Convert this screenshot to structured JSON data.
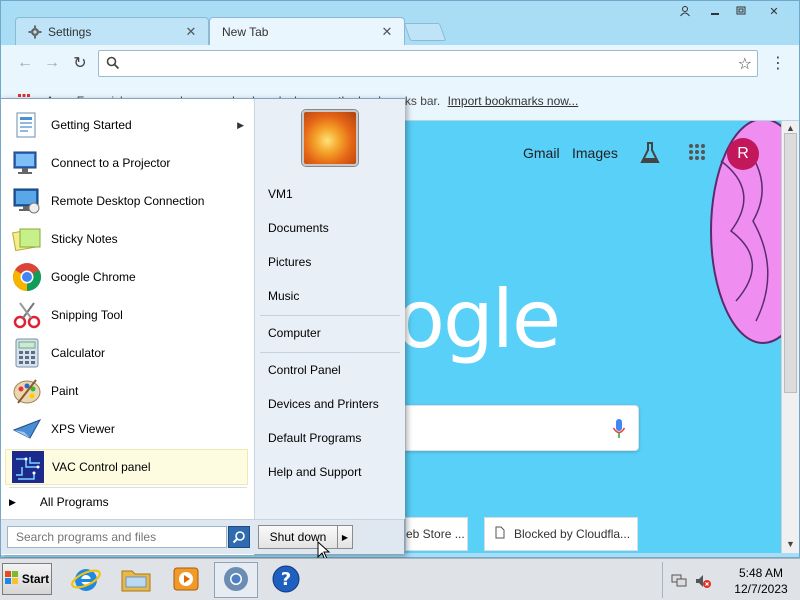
{
  "browser": {
    "tabs": [
      {
        "label": "Settings",
        "icon": "gear-icon"
      },
      {
        "label": "New Tab",
        "icon": "none"
      }
    ],
    "omnibox": {
      "value": "",
      "placeholder": ""
    },
    "bookmarks_bar": {
      "apps_label": "Apps",
      "text": "For quick access, place your bookmarks here on the bookmarks bar.",
      "link": "Import bookmarks now..."
    },
    "ntp": {
      "links": [
        "Gmail",
        "Images"
      ],
      "avatar_letter": "R",
      "logo_text": "ogle",
      "tiles": [
        {
          "label": "eb Store ..."
        },
        {
          "label": "Blocked by Cloudfla..."
        }
      ]
    },
    "colors": {
      "ntp_background": "#59d0f8",
      "avatar": "#c2185b",
      "frame": "#a9dcf5"
    }
  },
  "start_menu": {
    "programs": [
      {
        "label": "Getting Started",
        "icon": "getting-started-icon",
        "has_submenu": true
      },
      {
        "label": "Connect to a Projector",
        "icon": "projector-icon",
        "has_submenu": false
      },
      {
        "label": "Remote Desktop Connection",
        "icon": "remote-desktop-icon",
        "has_submenu": false
      },
      {
        "label": "Sticky Notes",
        "icon": "sticky-notes-icon",
        "has_submenu": false
      },
      {
        "label": "Google Chrome",
        "icon": "chrome-icon",
        "has_submenu": false
      },
      {
        "label": "Snipping Tool",
        "icon": "scissors-icon",
        "has_submenu": false
      },
      {
        "label": "Calculator",
        "icon": "calculator-icon",
        "has_submenu": false
      },
      {
        "label": "Paint",
        "icon": "paint-palette-icon",
        "has_submenu": false
      },
      {
        "label": "XPS Viewer",
        "icon": "xps-viewer-icon",
        "has_submenu": false
      },
      {
        "label": "VAC Control panel",
        "icon": "vac-control-icon",
        "has_submenu": false
      }
    ],
    "all_programs": "All Programs",
    "search_placeholder": "Search programs and files",
    "shutdown_label": "Shut down",
    "right_items": [
      {
        "label": "VM1"
      },
      {
        "label": "Documents"
      },
      {
        "label": "Pictures"
      },
      {
        "label": "Music"
      },
      {
        "label": "Computer"
      },
      {
        "label": "Control Panel"
      },
      {
        "label": "Devices and Printers"
      },
      {
        "label": "Default Programs"
      },
      {
        "label": "Help and Support"
      }
    ]
  },
  "taskbar": {
    "start_label": "Start",
    "pinned": [
      {
        "icon": "internet-explorer-icon"
      },
      {
        "icon": "file-explorer-icon"
      },
      {
        "icon": "media-player-icon"
      },
      {
        "icon": "chrome-icon"
      },
      {
        "icon": "help-icon"
      }
    ],
    "clock": {
      "time": "5:48 AM",
      "date": "12/7/2023"
    }
  }
}
